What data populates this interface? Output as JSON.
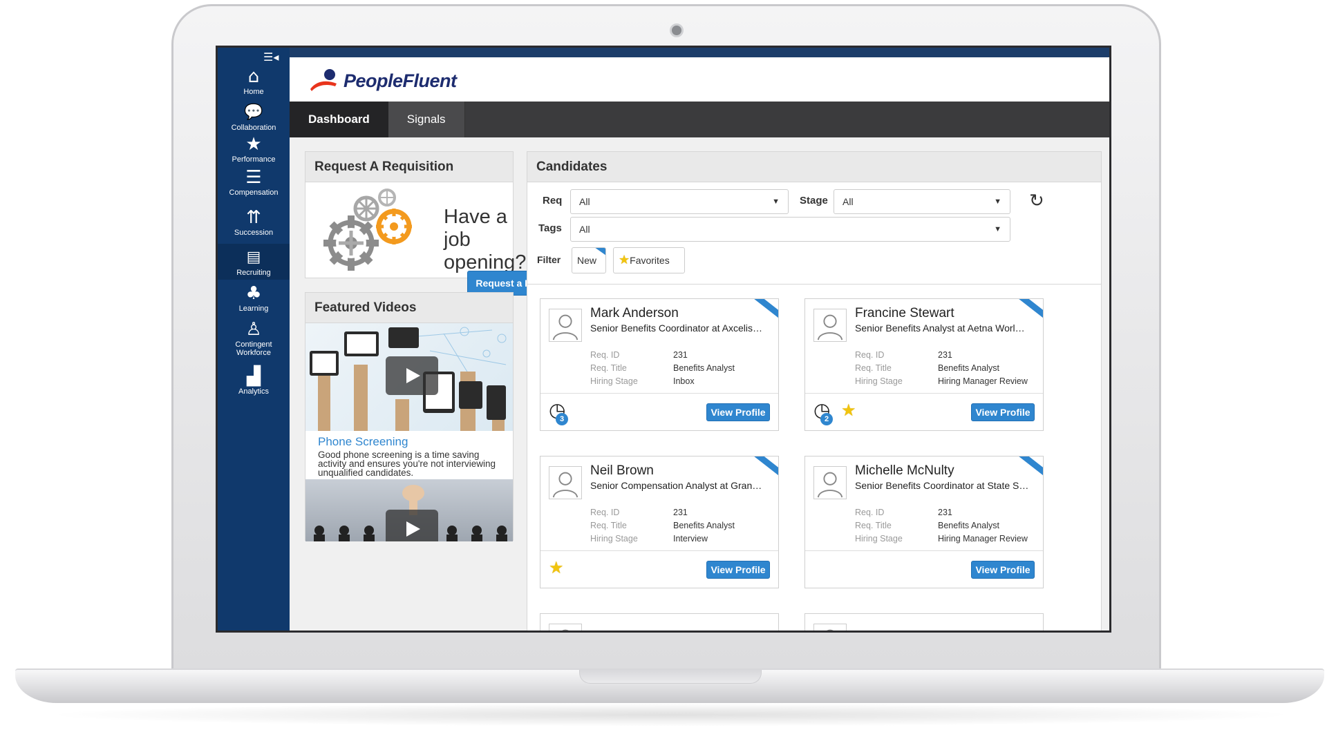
{
  "brand": {
    "name": "PeopleFluent"
  },
  "sidebar": {
    "menu_icon": "menu-collapse-icon",
    "items": [
      {
        "label": "Home",
        "icon": "home-icon"
      },
      {
        "label": "Collaboration",
        "icon": "chat-bubbles-icon"
      },
      {
        "label": "Performance",
        "icon": "star-icon"
      },
      {
        "label": "Compensation",
        "icon": "coins-icon"
      },
      {
        "label": "Succession",
        "icon": "org-chart-icon"
      },
      {
        "label": "Recruiting",
        "icon": "briefcase-icon",
        "active": true
      },
      {
        "label": "Learning",
        "icon": "tree-icon"
      },
      {
        "label": "Contingent Workforce",
        "icon": "person-clock-icon"
      },
      {
        "label": "Analytics",
        "icon": "bar-chart-icon"
      }
    ]
  },
  "tabs": [
    {
      "label": "Dashboard",
      "active": true
    },
    {
      "label": "Signals",
      "active": false
    }
  ],
  "requisition": {
    "title": "Request A Requisition",
    "prompt": "Have a job opening?",
    "button": "Request a Req"
  },
  "videos": {
    "title": "Featured Videos",
    "items": [
      {
        "title": "Phone Screening",
        "description": "Good phone screening is a time saving activity and ensures you're not interviewing unqualified candidates."
      }
    ]
  },
  "candidates": {
    "title": "Candidates",
    "filters": {
      "req_label": "Req",
      "req_value": "All",
      "stage_label": "Stage",
      "stage_value": "All",
      "tags_label": "Tags",
      "tags_value": "All",
      "filter_label": "Filter",
      "new_label": "New",
      "favorites_label": "Favorites"
    },
    "field_labels": {
      "req_id": "Req. ID",
      "req_title": "Req. Title",
      "hiring_stage": "Hiring Stage"
    },
    "view_button": "View Profile",
    "items": [
      {
        "name": "Mark Anderson",
        "title": "Senior Benefits Coordinator at Axcelis…",
        "req_id": "231",
        "req_title": "Benefits Analyst",
        "stage": "Inbox",
        "clock_count": "3",
        "favorite": false
      },
      {
        "name": "Francine Stewart",
        "title": "Senior Benefits Analyst at Aetna Worl…",
        "req_id": "231",
        "req_title": "Benefits Analyst",
        "stage": "Hiring Manager Review",
        "clock_count": "2",
        "favorite": true
      },
      {
        "name": "Neil Brown",
        "title": "Senior Compensation Analyst at Gran…",
        "req_id": "231",
        "req_title": "Benefits Analyst",
        "stage": "Interview",
        "clock_count": "",
        "favorite": true
      },
      {
        "name": "Michelle McNulty",
        "title": "Senior Benefits Coordinator at State S…",
        "req_id": "231",
        "req_title": "Benefits Analyst",
        "stage": "Hiring Manager Review",
        "clock_count": "",
        "favorite": false
      }
    ]
  },
  "colors": {
    "sidebar": "#10396c",
    "accent": "#2f86cf",
    "tabbar": "#3b3b3d",
    "star": "#f1c40f"
  }
}
